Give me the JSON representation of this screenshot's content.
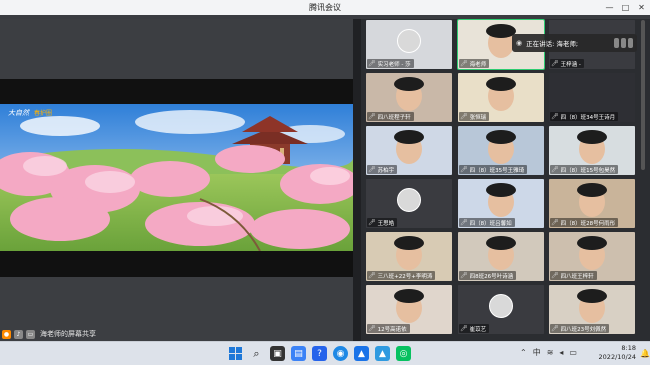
{
  "window": {
    "title": "腾讯会议",
    "controls": [
      "—",
      "□",
      "✕"
    ]
  },
  "share": {
    "logo_text": "大自然",
    "logo_tag": "春护圈",
    "footer_label": "海老师的屏幕共享"
  },
  "speaking_banner": "正在讲话: 海老师;",
  "participants": [
    {
      "name": "实习老师 - 莎",
      "bg": "#d6d8dc",
      "avatar": true
    },
    {
      "name": "海老师",
      "bg": "#e8e3d8",
      "active": true
    },
    {
      "name": "王梓涵 -",
      "bg": "#3a3b40"
    },
    {
      "name": "四八班程子轩",
      "bg": "#c9b8a8"
    },
    {
      "name": "张恒瑞",
      "bg": "#e9dfc8"
    },
    {
      "name": "四（8）班34号王诗月",
      "bg": "#2e2f34"
    },
    {
      "name": "苏柏宇",
      "bg": "#cfd8e6"
    },
    {
      "name": "四（8）班35号王雅琦",
      "bg": "#b8c7d8"
    },
    {
      "name": "四（8）班15号包昊然",
      "bg": "#d7dde0"
    },
    {
      "name": "王思皓",
      "bg": "#3a3b40",
      "avatar": true
    },
    {
      "name": "四（8）班吕馨如",
      "bg": "#cdd8e8"
    },
    {
      "name": "四（8）班28号何雨彤",
      "bg": "#c9b49a"
    },
    {
      "name": "三八班+22号+李明涛",
      "bg": "#d8cbb4"
    },
    {
      "name": "四8班26号叶诗涵",
      "bg": "#d2c9bc"
    },
    {
      "name": "四八班王梓轩",
      "bg": "#cdbfae"
    },
    {
      "name": "12号高诺依",
      "bg": "#e0d6cc"
    },
    {
      "name": "崔苡艺",
      "bg": "#3a3b40",
      "avatar": true
    },
    {
      "name": "四八班23号刘佩然",
      "bg": "#d8d0c4"
    }
  ],
  "taskbar": {
    "time": "8:18",
    "date": "2022/10/24",
    "ime": "中"
  },
  "colors": {
    "accent_green": "#2ecc71",
    "taskbar_bg": "#dde2ea",
    "window_bg": "#2b2d31"
  }
}
